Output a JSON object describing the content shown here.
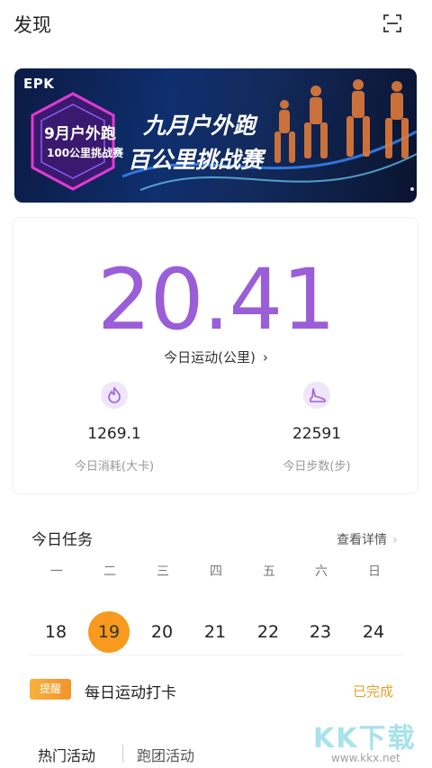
{
  "header": {
    "title": "发现"
  },
  "banner": {
    "brand": "EPK",
    "line1": "九月户外跑",
    "line2": "百公里挑战赛"
  },
  "stats": {
    "distance_value": "20.41",
    "distance_label": "今日运动(公里)",
    "calories_value": "1269.1",
    "calories_label": "今日消耗(大卡)",
    "steps_value": "22591",
    "steps_label": "今日步数(步)"
  },
  "tasks": {
    "title": "今日任务",
    "detail_link": "查看详情",
    "weekdays": [
      "一",
      "二",
      "三",
      "四",
      "五",
      "六",
      "日"
    ],
    "dates": [
      "18",
      "19",
      "20",
      "21",
      "22",
      "23",
      "24"
    ],
    "selected_date": "19",
    "badge": "提醒",
    "checkin_label": "每日运动打卡",
    "status": "已完成"
  },
  "tabs": [
    "热门活动",
    "跑团活动"
  ],
  "watermark": {
    "text": "KK下载",
    "url": "www.kkx.net"
  },
  "colors": {
    "primary_purple": "#9a5ed8",
    "selected_date_orange": "#f79a1d",
    "done_orange": "#e5a32b"
  }
}
